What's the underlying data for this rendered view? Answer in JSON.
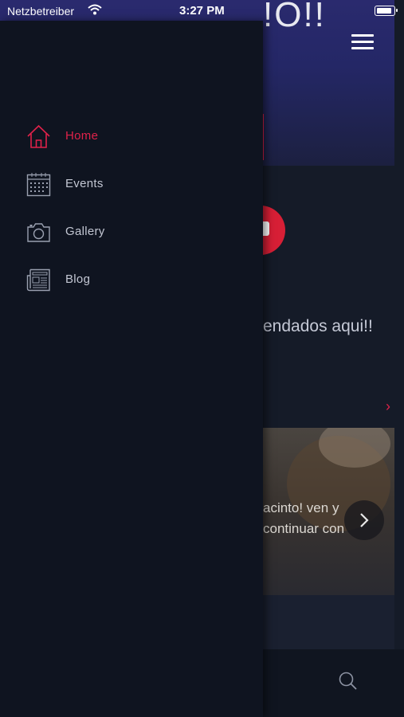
{
  "status_bar": {
    "carrier": "Netzbetreiber",
    "time": "3:27 PM"
  },
  "background_screen": {
    "hero_title_fragment": "!O!!",
    "welcome_fragment": "endados aqui!!",
    "card_text_line1": "acinto! ven y",
    "card_text_line2": "continuar con"
  },
  "drawer": {
    "items": [
      {
        "label": "Home",
        "icon": "home-icon",
        "active": true
      },
      {
        "label": "Events",
        "icon": "calendar-icon",
        "active": false
      },
      {
        "label": "Gallery",
        "icon": "camera-icon",
        "active": false
      },
      {
        "label": "Blog",
        "icon": "newspaper-icon",
        "active": false
      }
    ]
  },
  "colors": {
    "accent": "#e0224a",
    "drawer_bg": "#0f1420",
    "text": "#c3c7d3"
  }
}
